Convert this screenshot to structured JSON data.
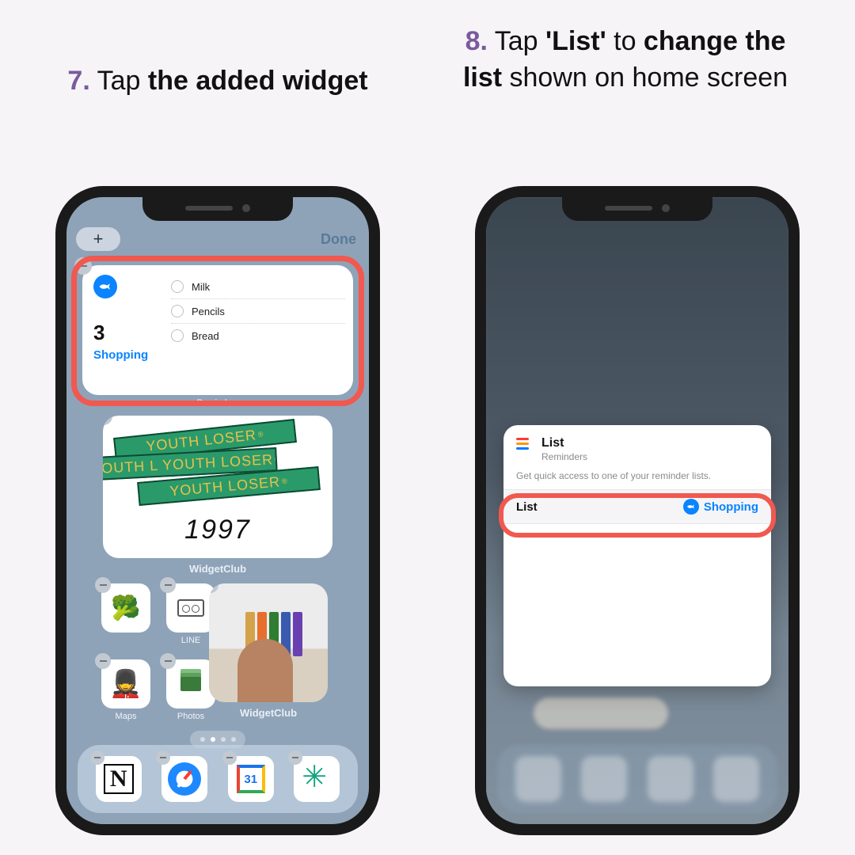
{
  "captions": {
    "left": {
      "num": "7.",
      "plain": " Tap ",
      "bold": "the added widget"
    },
    "right": {
      "num": "8.",
      "seg1": " Tap ",
      "bold1": "'List'",
      "seg2": " to ",
      "bold2": "change the list",
      "seg3": " shown on home screen"
    }
  },
  "left_phone": {
    "topbar": {
      "add": "+",
      "done": "Done"
    },
    "reminders": {
      "count": "3",
      "list_name": "Shopping",
      "items": [
        "Milk",
        "Pencils",
        "Bread"
      ],
      "caption": "Reminders"
    },
    "widgetclub": {
      "stripes": [
        "YOUTH LOSER",
        "YOUTH L YOUTH LOSER",
        "YOUTH LOSER"
      ],
      "year": "1997",
      "caption": "WidgetClub"
    },
    "apps": {
      "broccoli_emoji": "🥦",
      "line_label": "LINE",
      "soldier_emoji": "💂",
      "maps_label": "Maps",
      "photos_label": "Photos",
      "wc_photo_label": "WidgetClub"
    },
    "dock": {
      "gcal_day": "31"
    }
  },
  "right_phone": {
    "sheet": {
      "title": "List",
      "subtitle": "Reminders",
      "description": "Get quick access to one of your reminder lists.",
      "row_label": "List",
      "row_value": "Shopping"
    }
  }
}
